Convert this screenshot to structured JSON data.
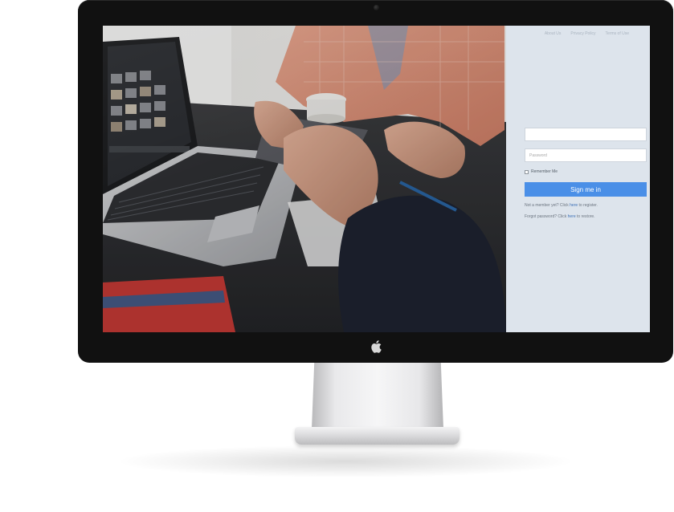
{
  "monitor": {
    "logo_icon": "apple-logo-icon",
    "camera_icon": "camera-icon"
  },
  "photo": {
    "description_icon": "workspace-photo"
  },
  "top_links": [
    "About Us",
    "Privacy Policy",
    "Terms of Use"
  ],
  "login": {
    "username_placeholder": "",
    "password_placeholder": "Password",
    "remember_label": "Remember Me",
    "signin_label": "Sign me in",
    "register_prefix": "Not a member yet? Click ",
    "register_link": "here",
    "register_suffix": " to register.",
    "forgot_prefix": "Forgot password? Click ",
    "forgot_link": "here",
    "forgot_suffix": " to restore."
  },
  "colors": {
    "panel_bg": "#dde4ec",
    "button": "#4a8fe7",
    "bezel": "#111111"
  }
}
